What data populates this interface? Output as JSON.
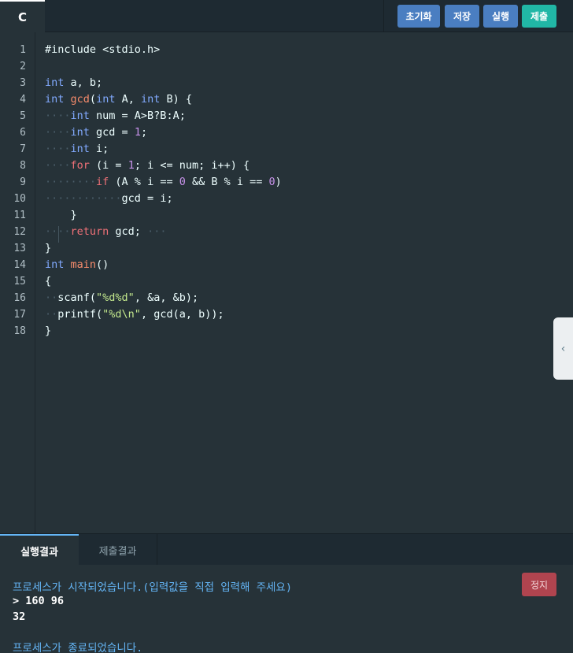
{
  "toolbar": {
    "language_tab": "C",
    "reset_label": "초기화",
    "save_label": "저장",
    "run_label": "실행",
    "submit_label": "제출"
  },
  "colors": {
    "reset": "#4a7ec1",
    "save": "#4a7ec1",
    "run": "#4a7ec1",
    "submit": "#21b7a6",
    "stop": "#b0444f"
  },
  "editor": {
    "line_numbers": [
      "1",
      "2",
      "3",
      "4",
      "5",
      "6",
      "7",
      "8",
      "9",
      "10",
      "11",
      "12",
      "13",
      "14",
      "15",
      "16",
      "17",
      "18"
    ],
    "lines": [
      [
        {
          "t": "#include <stdio.h>"
        }
      ],
      [],
      [
        {
          "t": "int",
          "c": "kw"
        },
        {
          "t": " a, b;"
        }
      ],
      [
        {
          "t": "int",
          "c": "kw"
        },
        {
          "t": " "
        },
        {
          "t": "gcd",
          "c": "fn"
        },
        {
          "t": "("
        },
        {
          "t": "int",
          "c": "kw"
        },
        {
          "t": " A, "
        },
        {
          "t": "int",
          "c": "kw"
        },
        {
          "t": " B) {"
        }
      ],
      [
        {
          "t": "····",
          "c": "ws"
        },
        {
          "t": "int",
          "c": "kw"
        },
        {
          "t": " num = A>B?B:A;"
        }
      ],
      [
        {
          "t": "····",
          "c": "ws"
        },
        {
          "t": "int",
          "c": "kw"
        },
        {
          "t": " gcd = "
        },
        {
          "t": "1",
          "c": "num"
        },
        {
          "t": ";"
        }
      ],
      [
        {
          "t": "····",
          "c": "ws"
        },
        {
          "t": "int",
          "c": "kw"
        },
        {
          "t": " i;"
        }
      ],
      [
        {
          "t": "····",
          "c": "ws"
        },
        {
          "t": "for",
          "c": "ctl"
        },
        {
          "t": " (i = "
        },
        {
          "t": "1",
          "c": "num"
        },
        {
          "t": "; i <= num; i++) {"
        }
      ],
      [
        {
          "t": "········",
          "c": "ws"
        },
        {
          "t": "if",
          "c": "ctl"
        },
        {
          "t": " (A % i == "
        },
        {
          "t": "0",
          "c": "num"
        },
        {
          "t": " && B % i == "
        },
        {
          "t": "0",
          "c": "num"
        },
        {
          "t": ")"
        }
      ],
      [
        {
          "t": "············",
          "c": "ws"
        },
        {
          "t": "gcd = i;"
        }
      ],
      [
        {
          "t": "    }"
        }
      ],
      [
        {
          "t": "····",
          "c": "ws"
        },
        {
          "t": "return",
          "c": "ctl"
        },
        {
          "t": " gcd; "
        },
        {
          "t": "···",
          "c": "ws"
        }
      ],
      [
        {
          "t": "}"
        }
      ],
      [
        {
          "t": "int",
          "c": "kw"
        },
        {
          "t": " "
        },
        {
          "t": "main",
          "c": "fn"
        },
        {
          "t": "()"
        }
      ],
      [
        {
          "t": "{"
        }
      ],
      [
        {
          "t": "··",
          "c": "ws"
        },
        {
          "t": "scanf("
        },
        {
          "t": "\"%d%d\"",
          "c": "str"
        },
        {
          "t": ", &a, &b);"
        }
      ],
      [
        {
          "t": "··",
          "c": "ws"
        },
        {
          "t": "printf("
        },
        {
          "t": "\"%d\\n\"",
          "c": "str"
        },
        {
          "t": ", gcd(a, b));"
        }
      ],
      [
        {
          "t": "}"
        }
      ]
    ]
  },
  "side_handle": {
    "icon": "chevron-left-icon",
    "glyph": "‹"
  },
  "bottom_tabs": {
    "run_result": "실행결과",
    "submit_result": "제출결과"
  },
  "console": {
    "stop_label": "정지",
    "lines": [
      "프로세스가 시작되었습니다.(입력값을 직접 입력해 주세요)",
      "> 160 96",
      "32",
      "프로세스가 종료되었습니다."
    ]
  }
}
